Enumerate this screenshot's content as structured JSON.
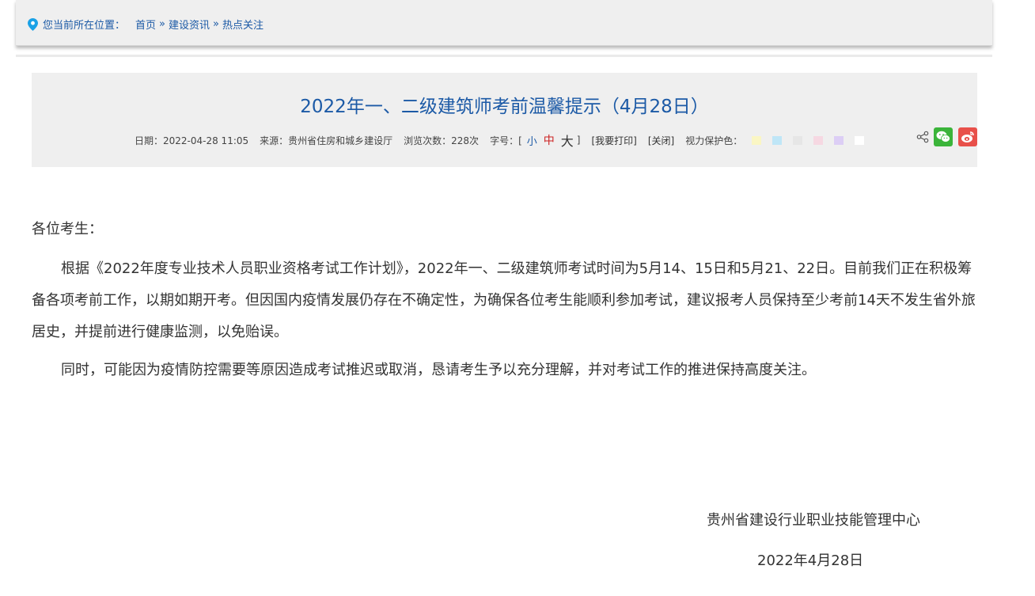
{
  "breadcrumb": {
    "label": "您当前所在位置：",
    "items": [
      "首页",
      "建设资讯",
      "热点关注"
    ],
    "separator": "»"
  },
  "article": {
    "title": "2022年一、二级建筑师考前温馨提示（4月28日）",
    "meta": {
      "date": "日期：2022-04-28 11:05",
      "source": "来源：贵州省住房和城乡建设厅",
      "views": "浏览次数：228次",
      "font_size_label": "字号：[",
      "font_small": "小",
      "font_medium": "中",
      "font_large": "大",
      "font_close_bracket": "]",
      "print": "[我要打印]",
      "close": "[关闭]",
      "eye_protect_label": "视力保护色："
    },
    "eye_colors": [
      "#faf6c4",
      "#bfe6f7",
      "#e6e6e6",
      "#f6d8e2",
      "#dccef5",
      "#ffffff"
    ],
    "share_icons": [
      "share-icon",
      "wechat-icon",
      "weibo-icon"
    ],
    "greeting": "各位考生：",
    "paragraphs": [
      "根据《2022年度专业技术人员职业资格考试工作计划》，2022年一、二级建筑师考试时间为5月14、15日和5月21、22日。目前我们正在积极筹备各项考前工作，以期如期开考。但因国内疫情发展仍存在不确定性，为确保各位考生能顺利参加考试，建议报考人员保持至少考前14天不发生省外旅居史，并提前进行健康监测，以免贻误。",
      "同时，可能因为疫情防控需要等原因造成考试推迟或取消，恳请考生予以充分理解，并对考试工作的推进保持高度关注。"
    ],
    "signature": "贵州省建设行业职业技能管理中心",
    "sign_date": "2022年4月28日"
  },
  "colors": {
    "accent": "#1c5aa6",
    "font_medium": "#cc2222",
    "header_bg": "#efefef",
    "wechat": "#3bb43a",
    "weibo": "#e8504a"
  }
}
